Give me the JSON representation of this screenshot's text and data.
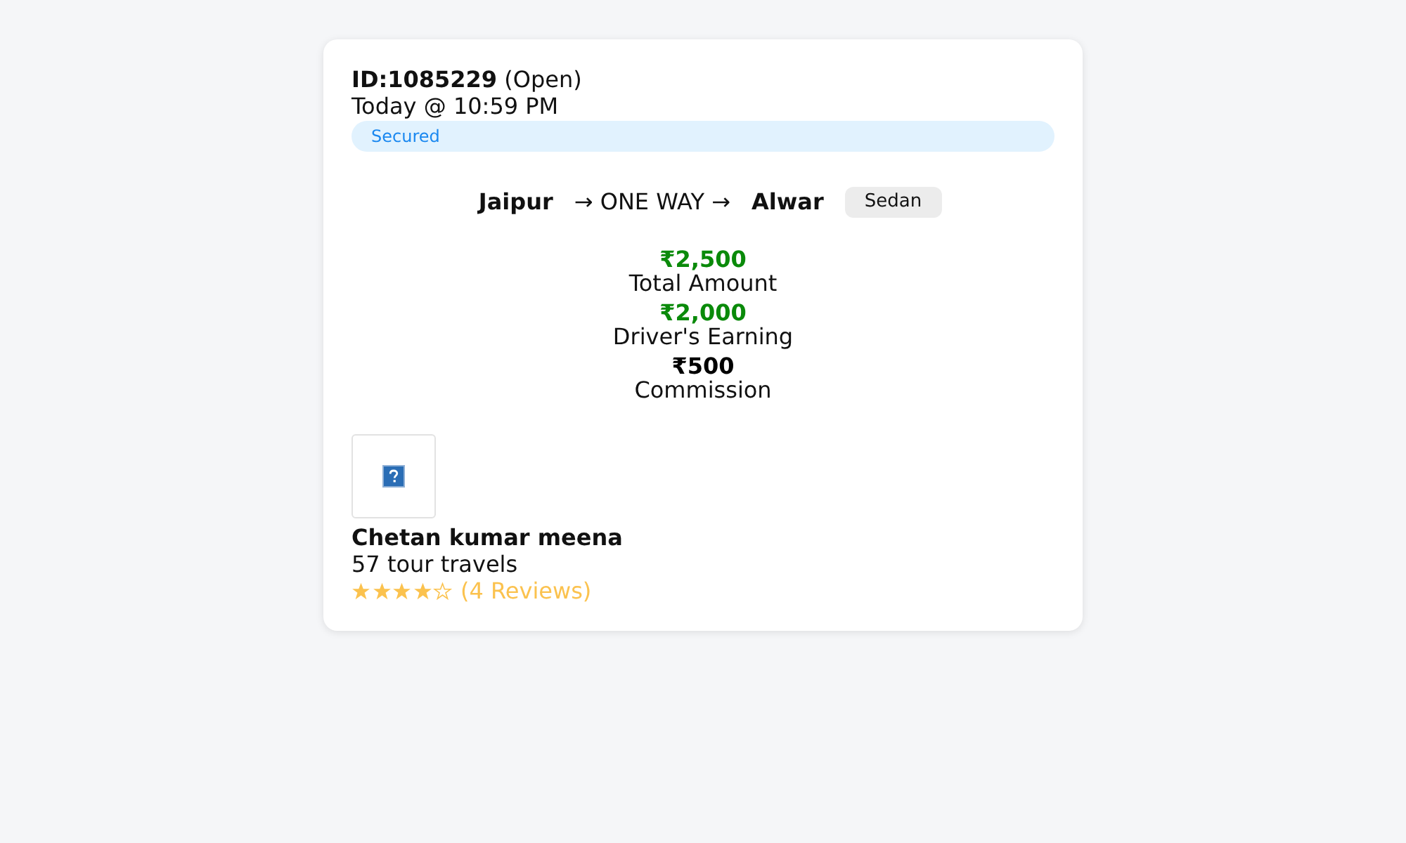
{
  "booking": {
    "id_label": "ID:1085229",
    "status": "(Open)",
    "time": "Today @ 10:59 PM",
    "badge": "Secured"
  },
  "route": {
    "from": "Jaipur",
    "trip_type": "→ ONE WAY →",
    "to": "Alwar",
    "vehicle": "Sedan"
  },
  "amounts": [
    {
      "value": "₹2,500",
      "label": "Total Amount",
      "kind": "highlight"
    },
    {
      "value": "₹2,000",
      "label": "Driver's Earning",
      "kind": "highlight"
    },
    {
      "value": "₹500",
      "label": "Commission",
      "kind": "plain"
    }
  ],
  "driver": {
    "name": "Chetan kumar meena",
    "company": "57 tour travels",
    "stars": 4,
    "reviews": "(4 Reviews)"
  }
}
